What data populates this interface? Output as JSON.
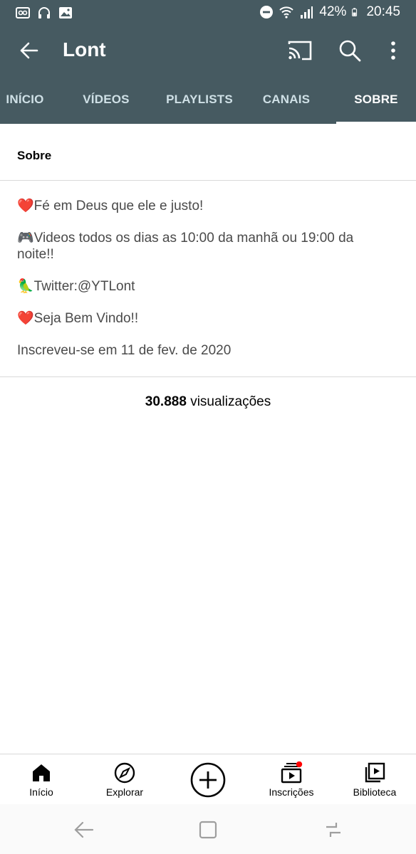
{
  "status_bar": {
    "battery": "42%",
    "time": "20:45"
  },
  "app_bar": {
    "title": "Lont",
    "icons": [
      "back-arrow-icon",
      "cast-icon",
      "search-icon",
      "more-vert-icon"
    ]
  },
  "tabs": [
    {
      "label": "INÍCIO"
    },
    {
      "label": "VÍDEOS"
    },
    {
      "label": "PLAYLISTS"
    },
    {
      "label": "CANAIS"
    },
    {
      "label": "SOBRE",
      "active": true
    }
  ],
  "about": {
    "heading": "Sobre",
    "lines": [
      "❤️Fé em Deus que ele e justo!",
      "🎮Videos todos os dias as 10:00 da manhã ou 19:00 da noite!!",
      "🦜Twitter:@YTLont",
      "❤️Seja Bem Vindo!!"
    ],
    "joined": "Inscreveu-se em 11 de fev. de 2020",
    "views_count": "30.888",
    "views_label": "visualizações"
  },
  "bottom_nav": {
    "items": [
      {
        "label": "Início",
        "icon": "home-icon"
      },
      {
        "label": "Explorar",
        "icon": "compass-icon"
      },
      {
        "label": "",
        "icon": "add-circle-icon"
      },
      {
        "label": "Inscrições",
        "icon": "subscriptions-icon"
      },
      {
        "label": "Biblioteca",
        "icon": "library-icon"
      }
    ]
  },
  "colors": {
    "header": "#465a61",
    "notification_dot": "#ff0000"
  }
}
